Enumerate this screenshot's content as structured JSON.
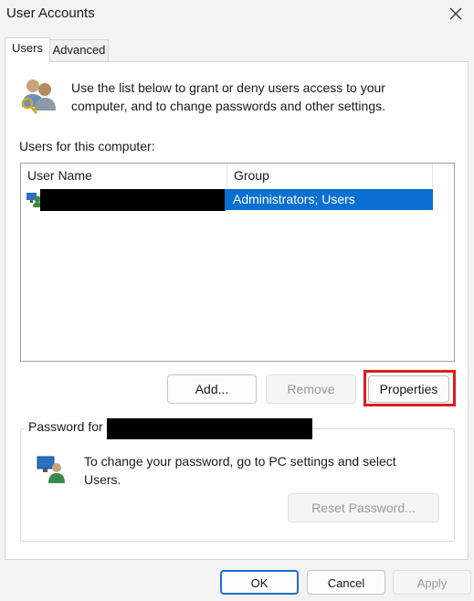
{
  "window": {
    "title": "User Accounts",
    "close_icon": "close-icon"
  },
  "tabs": [
    {
      "label": "Users",
      "active": true
    },
    {
      "label": "Advanced",
      "active": false
    }
  ],
  "intro": {
    "icon": "users-keys-icon",
    "text": "Use the list below to grant or deny users access to your computer, and to change passwords and other settings."
  },
  "users_list": {
    "label": "Users for this computer:",
    "columns": [
      "User Name",
      "Group"
    ],
    "rows": [
      {
        "user_name": "",
        "group": "Administrators; Users",
        "selected": true
      }
    ]
  },
  "buttons": {
    "add": "Add...",
    "remove": "Remove",
    "properties": "Properties"
  },
  "password_group": {
    "label": "Password for",
    "icon": "user-monitor-icon",
    "text": "To change your password, go to PC settings and select Users.",
    "reset_button": "Reset Password..."
  },
  "footer": {
    "ok": "OK",
    "cancel": "Cancel",
    "apply": "Apply"
  },
  "colors": {
    "selection": "#0a6fd1",
    "highlight": "#e01b1b",
    "default_button_border": "#1a6fc7"
  }
}
